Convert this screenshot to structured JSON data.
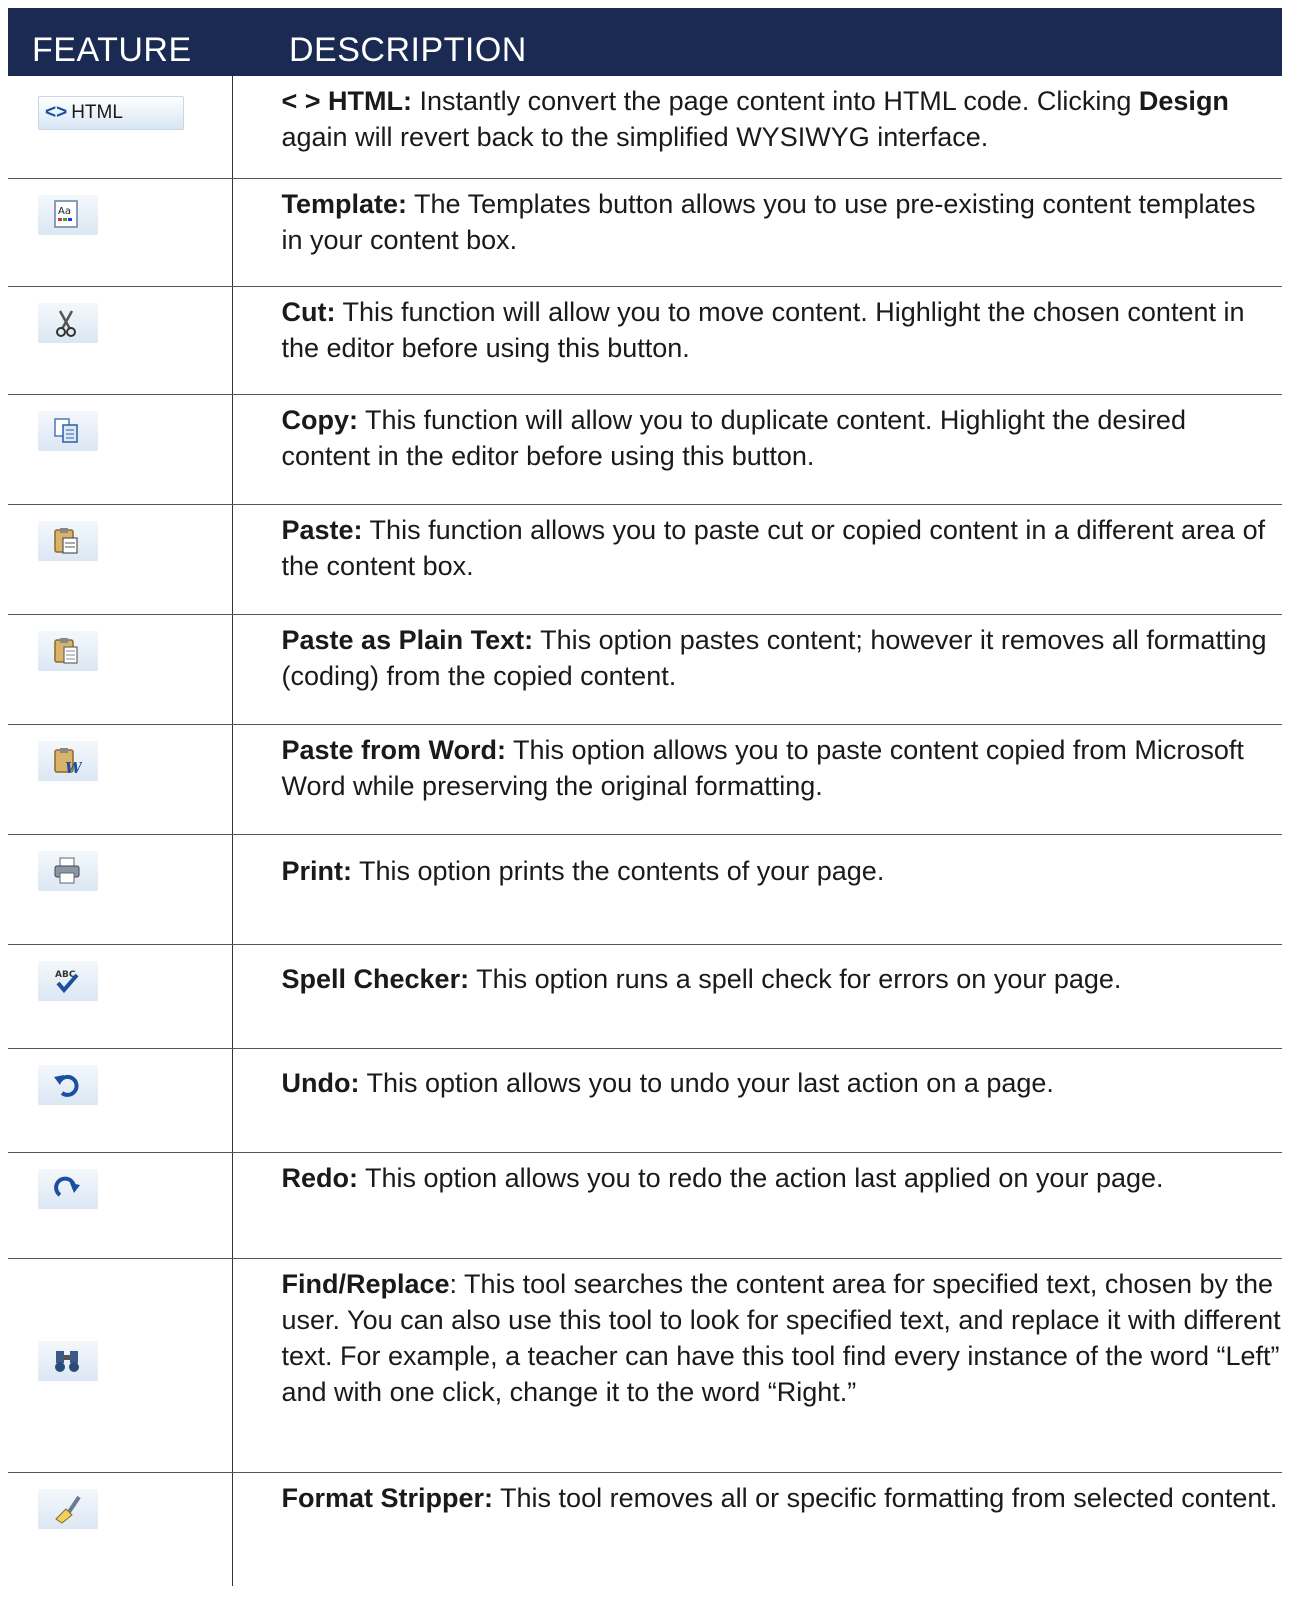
{
  "header": {
    "feature": "FEATURE",
    "description": "DESCRIPTION"
  },
  "rows": [
    {
      "icon": "html-icon",
      "icon_text": "HTML",
      "title": "< > HTML:",
      "parts": [
        " Instantly convert the page content into HTML code. Clicking ",
        " again will revert back to the simplified WYSIWYG interface."
      ],
      "bold_inline": "Design"
    },
    {
      "icon": "template-icon",
      "title": "Template:",
      "text": " The Templates button allows you to use pre-existing content templates in your content box."
    },
    {
      "icon": "scissors-icon",
      "title": "Cut:",
      "text": "  This function will allow you to move content. Highlight the chosen content in the editor before using this button."
    },
    {
      "icon": "copy-icon",
      "title": "Copy:",
      "text": " This function will allow you to duplicate content. Highlight the desired content in the editor before using this button."
    },
    {
      "icon": "paste-icon",
      "title": "Paste:",
      "text": " This function allows you to paste cut or copied content in a different area of the content box."
    },
    {
      "icon": "paste-plain-text-icon",
      "title": "Paste as Plain Text:",
      "text": " This option pastes content; however it removes all formatting (coding) from the copied content."
    },
    {
      "icon": "paste-from-word-icon",
      "title": "Paste from Word:",
      "text": " This option allows you to paste content copied from Microsoft Word while preserving the original formatting."
    },
    {
      "icon": "print-icon",
      "title": "Print:",
      "text": " This option prints the contents of your page."
    },
    {
      "icon": "spell-check-icon",
      "icon_text": "ABC",
      "title": "Spell Checker:",
      "text": " This option runs a spell check for errors on your page."
    },
    {
      "icon": "undo-icon",
      "title": "Undo:",
      "text": " This option allows you to undo your last action on a page."
    },
    {
      "icon": "redo-icon",
      "title": "Redo:",
      "text": " This option allows you to redo the action last applied on your page."
    },
    {
      "icon": "binoculars-icon",
      "title": "Find/Replace",
      "text": ": This tool searches the content area for specified text, chosen by the user. You can also use this tool to look for specified text, and replace it with different text. For example, a teacher can have this tool find every instance of the word “Left” and with one click, change it to the word “Right.”"
    },
    {
      "icon": "format-stripper-icon",
      "title": "Format Stripper:",
      "text": " This tool removes all or specific formatting from selected content."
    }
  ]
}
